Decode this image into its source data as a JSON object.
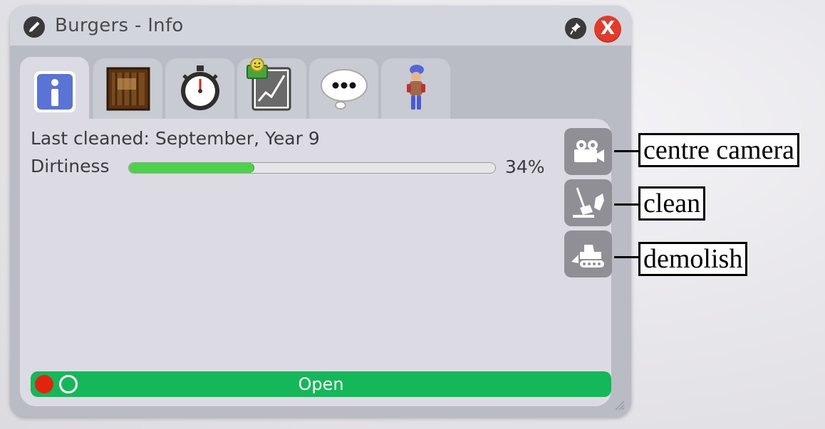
{
  "window": {
    "title": "Burgers - Info",
    "title_icon": "pencil-icon",
    "pin_icon": "pin-icon",
    "close_label": "X"
  },
  "tabs": [
    {
      "name": "info",
      "icon": "info-icon",
      "active": true
    },
    {
      "name": "stock",
      "icon": "crate-icon",
      "active": false
    },
    {
      "name": "timing",
      "icon": "stopwatch-icon",
      "active": false
    },
    {
      "name": "finance",
      "icon": "profit-chart-icon",
      "active": false
    },
    {
      "name": "thoughts",
      "icon": "speech-bubble-icon",
      "active": false
    },
    {
      "name": "staff",
      "icon": "staff-figure-icon",
      "active": false
    }
  ],
  "info": {
    "last_cleaned_label": "Last cleaned:",
    "last_cleaned_value": " September, Year 9",
    "dirtiness_label": "Dirtiness",
    "dirtiness_fraction": 0.34,
    "dirtiness_text": "34%"
  },
  "side_buttons": [
    {
      "name": "centre-camera",
      "icon": "video-camera-icon"
    },
    {
      "name": "clean",
      "icon": "broom-icon"
    },
    {
      "name": "demolish",
      "icon": "bulldozer-icon"
    }
  ],
  "callouts": {
    "camera": "centre camera",
    "clean": "clean",
    "demolish": "demolish"
  },
  "status": {
    "label": "Open",
    "color": "#14b858"
  },
  "colors": {
    "accent_close": "#e23b2c",
    "progress_fill": "#4cd34a"
  }
}
